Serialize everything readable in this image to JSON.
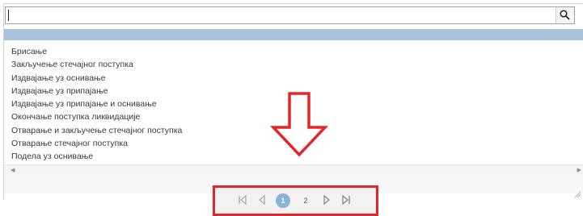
{
  "search": {
    "value": ""
  },
  "options": [
    "Брисање",
    "Закључење стечајног поступка",
    "Издвајање уз оснивање",
    "Издвајање уз припајање",
    "Издвајање уз припајање и оснивање",
    "Окончање поступка ликвидације",
    "Отварање и закључење стечајног поступка",
    "Отварање стечајног поступка",
    "Подела уз оснивање"
  ],
  "pager": {
    "first_icon": "first-page-icon",
    "prev_icon": "prev-page-icon",
    "current_page": "1",
    "next_page_label": "2",
    "next_icon": "next-page-icon",
    "last_icon": "last-page-icon"
  },
  "colors": {
    "selected_row": "#a9c3dd",
    "active_page": "#8ab4d6",
    "highlight_annotation": "#e3252c"
  }
}
